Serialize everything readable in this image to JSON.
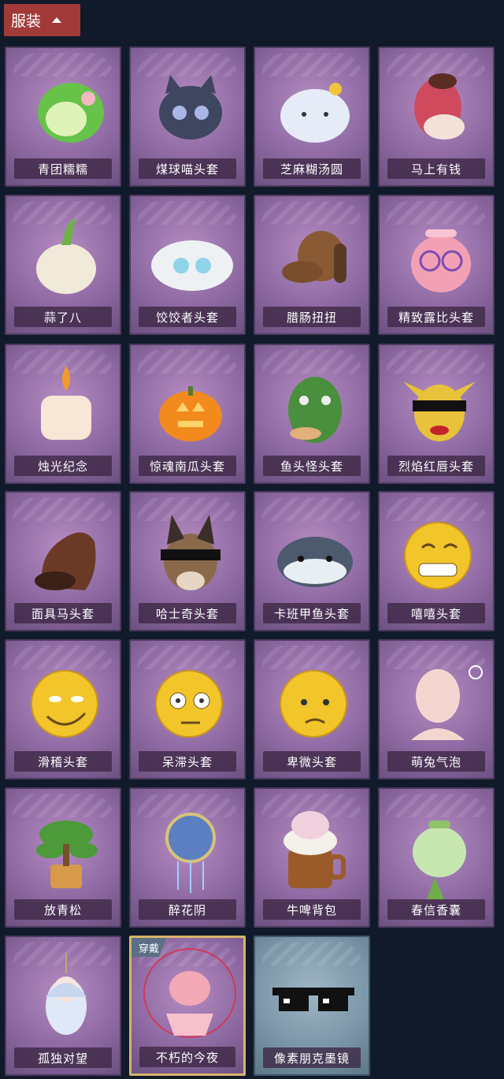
{
  "header": {
    "label": "服装",
    "chevron_icon": "chevron-up-icon"
  },
  "items": [
    {
      "name": "青团糯糯",
      "icon": "green-dumpling-icon"
    },
    {
      "name": "煤球喵头套",
      "icon": "black-cat-mask-icon"
    },
    {
      "name": "芝麻糊汤圆",
      "icon": "rice-ball-icon"
    },
    {
      "name": "马上有钱",
      "icon": "red-horse-mask-icon"
    },
    {
      "name": "蒜了八",
      "icon": "garlic-icon"
    },
    {
      "name": "饺饺者头套",
      "icon": "dumpling-mask-icon"
    },
    {
      "name": "腊肠扭扭",
      "icon": "dachshund-mask-icon"
    },
    {
      "name": "精致露比头套",
      "icon": "pink-beaver-mask-icon"
    },
    {
      "name": "烛光纪念",
      "icon": "candle-icon"
    },
    {
      "name": "惊魂南瓜头套",
      "icon": "pumpkin-mask-icon"
    },
    {
      "name": "鱼头怪头套",
      "icon": "fish-head-mask-icon"
    },
    {
      "name": "烈焰红唇头套",
      "icon": "yellow-mask-sunglasses-icon"
    },
    {
      "name": "面具马头套",
      "icon": "horse-mask-icon"
    },
    {
      "name": "哈士奇头套",
      "icon": "husky-mask-icon"
    },
    {
      "name": "卡班甲鱼头套",
      "icon": "turtle-mask-icon"
    },
    {
      "name": "嘻嘻头套",
      "icon": "grin-emoji-mask-icon"
    },
    {
      "name": "滑稽头套",
      "icon": "smirk-emoji-mask-icon"
    },
    {
      "name": "呆滞头套",
      "icon": "dazed-emoji-mask-icon"
    },
    {
      "name": "卑微头套",
      "icon": "pleading-emoji-mask-icon"
    },
    {
      "name": "萌兔气泡",
      "icon": "bubble-head-icon"
    },
    {
      "name": "放青松",
      "icon": "pine-bonsai-icon"
    },
    {
      "name": "醉花阴",
      "icon": "flower-ornament-icon"
    },
    {
      "name": "牛啤背包",
      "icon": "cow-beer-backpack-icon"
    },
    {
      "name": "春信香囊",
      "icon": "green-sachet-icon"
    },
    {
      "name": "孤独对望",
      "icon": "charm-figure-icon"
    },
    {
      "name": "不朽的今夜",
      "icon": "pink-fox-bowl-icon",
      "badge": "穿戴",
      "selected": true
    },
    {
      "name": "像素朋克墨镜",
      "icon": "pixel-sunglasses-icon",
      "grey": true
    }
  ],
  "colors": {
    "background": "#101a2a",
    "header_button": "#a33a3a",
    "card": "#8f6aa3",
    "card_selected_border": "#d8b46a",
    "card_grey": "#7c97a9"
  }
}
